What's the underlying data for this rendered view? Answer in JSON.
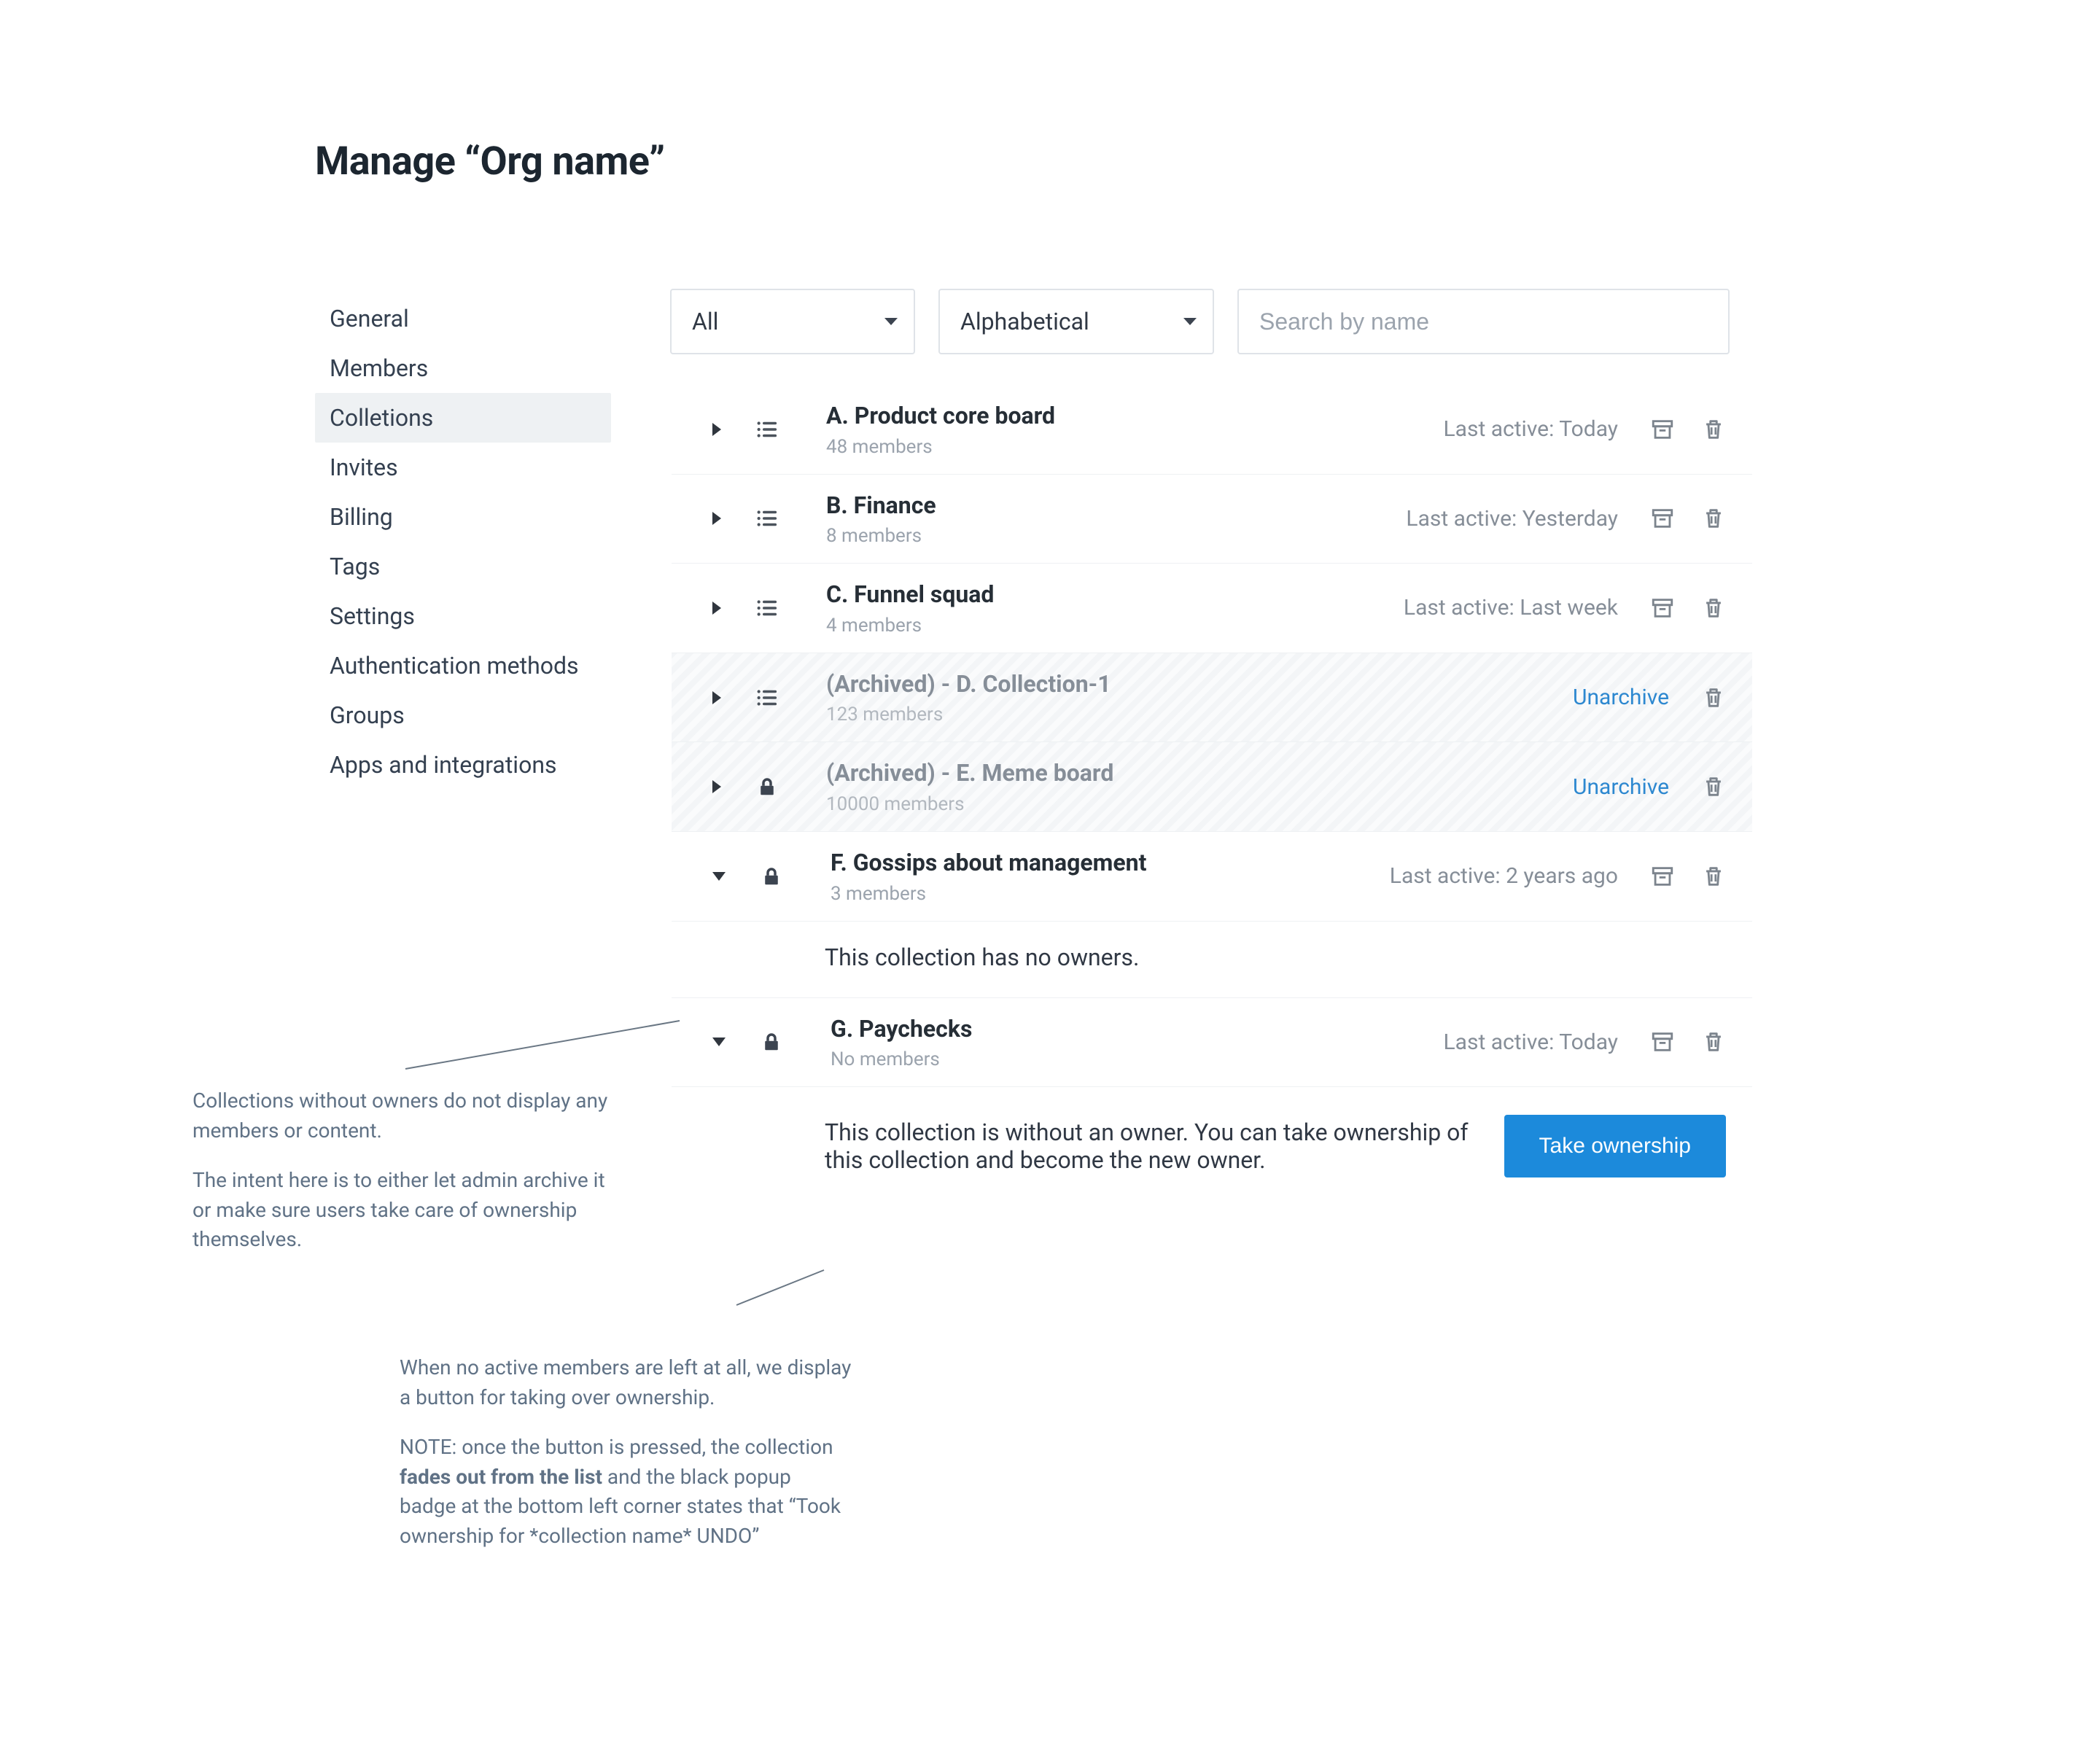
{
  "page_title": "Manage “Org name”",
  "sidebar": {
    "items": [
      {
        "label": "General"
      },
      {
        "label": "Members"
      },
      {
        "label": "Colletions",
        "active": true
      },
      {
        "label": "Invites"
      },
      {
        "label": "Billing"
      },
      {
        "label": "Tags"
      },
      {
        "label": "Settings"
      },
      {
        "label": "Authentication methods"
      },
      {
        "label": "Groups"
      },
      {
        "label": "Apps and integrations"
      }
    ]
  },
  "filters": {
    "scope": "All",
    "sort": "Alphabetical",
    "search_placeholder": "Search by name"
  },
  "rows": [
    {
      "title": "A. Product core board",
      "sub": "48 members",
      "meta": "Last active: Today",
      "icon": "list",
      "expanded": false,
      "archived": false,
      "actions": [
        "archive",
        "delete"
      ]
    },
    {
      "title": "B. Finance",
      "sub": "8 members",
      "meta": "Last active: Yesterday",
      "icon": "list",
      "expanded": false,
      "archived": false,
      "actions": [
        "archive",
        "delete"
      ]
    },
    {
      "title": "C. Funnel squad",
      "sub": "4 members",
      "meta": "Last active: Last week",
      "icon": "list",
      "expanded": false,
      "archived": false,
      "actions": [
        "archive",
        "delete"
      ]
    },
    {
      "title": "(Archived) - D. Collection-1",
      "sub": "123 members",
      "link": "Unarchive",
      "icon": "list",
      "expanded": false,
      "archived": true,
      "actions": [
        "delete"
      ]
    },
    {
      "title": "(Archived) - E. Meme board",
      "sub": "10000 members",
      "link": "Unarchive",
      "icon": "lock",
      "expanded": false,
      "archived": true,
      "actions": [
        "delete"
      ]
    },
    {
      "title": "F. Gossips about management",
      "sub": "3 members",
      "meta": "Last active: 2 years ago",
      "icon": "lock",
      "expanded": true,
      "archived": false,
      "actions": [
        "archive",
        "delete"
      ],
      "expanded_content": "This collection has no owners."
    },
    {
      "title": "G. Paychecks",
      "sub": "No members",
      "meta": "Last active: Today",
      "icon": "lock",
      "expanded": true,
      "archived": false,
      "actions": [
        "archive",
        "delete"
      ],
      "expanded_content": "This collection is without an owner. You can take ownership of this collection and become the new owner.",
      "button": "Take ownership"
    }
  ],
  "annotations": {
    "a1_p1": "Collections without owners do not display any members or content.",
    "a1_p2": "The intent here is to either let admin archive it or make sure users take care of ownership themselves.",
    "a2_p1": "When no active members are left at all, we display a button for taking over ownership.",
    "a2_p2a": "NOTE: once the button is pressed, the collection ",
    "a2_p2b": "fades out from the list",
    "a2_p2c": " and the black popup badge at the bottom left corner states that “Took ownership for *collection name* UNDO”"
  }
}
